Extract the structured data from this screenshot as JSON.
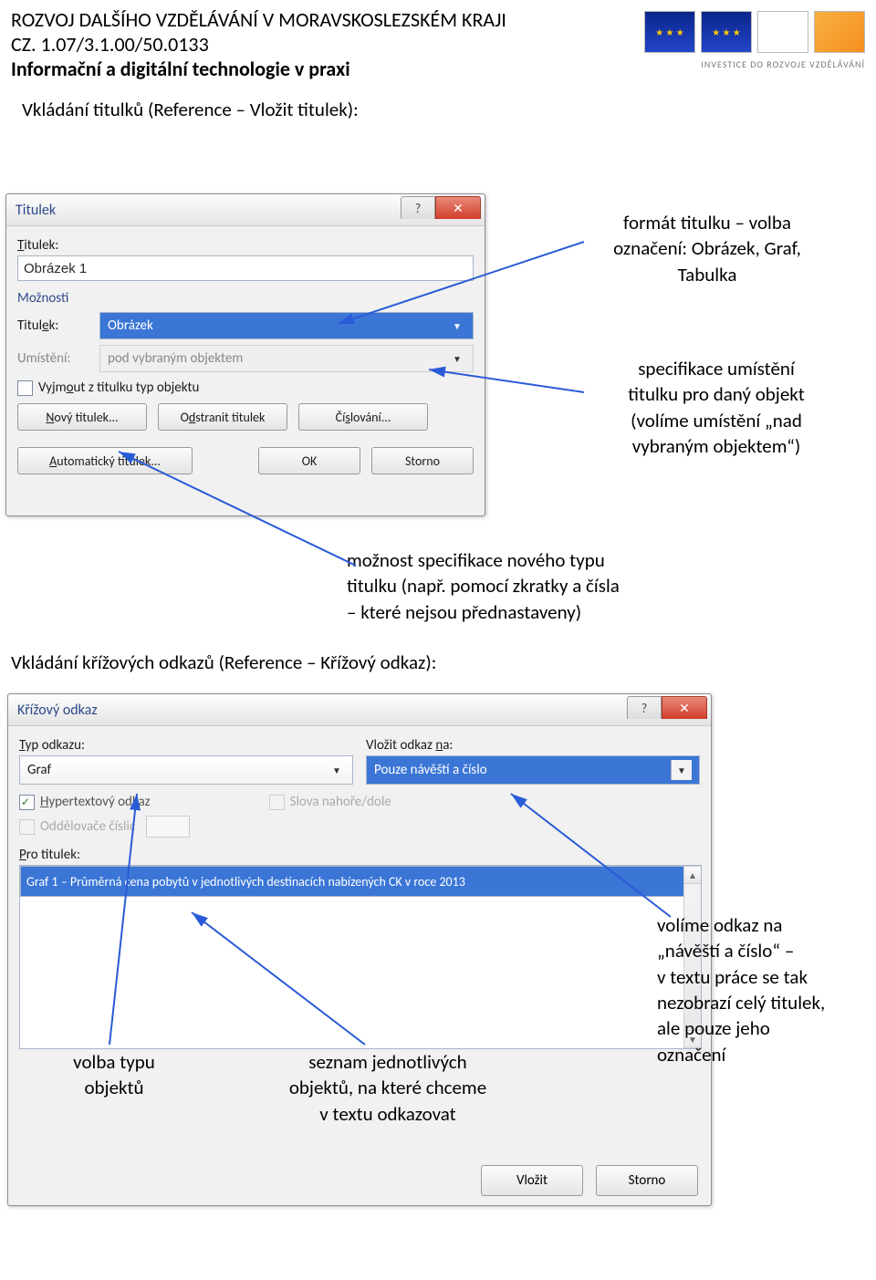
{
  "header": {
    "title": "ROZVOJ DALŠÍHO VZDĚLÁVÁNÍ V MORAVSKOSLEZSKÉM KRAJI",
    "code": "CZ. 1.07/3.1.00/50.0133",
    "subtitle": "Informační a digitální technologie v praxi",
    "invest": "INVESTICE DO ROZVOJE VZDĚLÁVÁNÍ"
  },
  "sections": {
    "s1": "Vkládání titulků (Reference – Vložit titulek):",
    "s2": "Vkládání křížových odkazů (Reference – Křížový odkaz):"
  },
  "dlg1": {
    "title": "Titulek",
    "label_titulek": "Titulek:",
    "value_titulek": "Obrázek 1",
    "moznosti": "Možnosti",
    "row_titulek": "Titulek:",
    "sel_titulek": "Obrázek",
    "row_umisteni": "Umístění:",
    "sel_umisteni": "pod vybraným objektem",
    "chk_vyjmout": "Vyjmout z titulku typ objektu",
    "btn_novy": "Nový titulek...",
    "btn_odstranit": "Odstranit titulek",
    "btn_cislovani": "Číslování...",
    "btn_auto": "Automatický titulek...",
    "btn_ok": "OK",
    "btn_storno": "Storno"
  },
  "dlg2": {
    "title": "Křížový odkaz",
    "typ_label": "Typ odkazu:",
    "typ_value": "Graf",
    "vlozit_label": "Vložit odkaz na:",
    "vlozit_value": "Pouze návěští a číslo",
    "hyper": "Hypertextový odkaz",
    "slova": "Slova nahoře/dole",
    "oddel": "Oddělovače číslic",
    "pro_label": "Pro titulek:",
    "list_item": "Graf  1 – Průměrná cena pobytů v jednotlivých destinacích nabízených CK v roce 2013",
    "btn_vlozit": "Vložit",
    "btn_storno": "Storno"
  },
  "anno": {
    "a1_l1": "formát titulku – volba",
    "a1_l2": "označení: Obrázek, Graf,",
    "a1_l3": "Tabulka",
    "a2_l1": "specifikace umístění",
    "a2_l2": "titulku pro daný objekt",
    "a2_l3": "(volíme umístění „nad",
    "a2_l4": "vybraným objektem“)",
    "a3_l1": "možnost specifikace nového typu",
    "a3_l2": "titulku (např. pomocí zkratky a čísla",
    "a3_l3": "– které nejsou přednastaveny)",
    "a4_l1": "volba typu",
    "a4_l2": "objektů",
    "a5_l1": "seznam jednotlivých",
    "a5_l2": "objektů, na které chceme",
    "a5_l3": "v textu odkazovat",
    "a6_l1": "volíme odkaz na",
    "a6_l2": "„návěští a číslo“ –",
    "a6_l3": "v textu práce se tak",
    "a6_l4": "nezobrazí celý titulek,",
    "a6_l5": "ale pouze jeho",
    "a6_l6": "označení"
  }
}
